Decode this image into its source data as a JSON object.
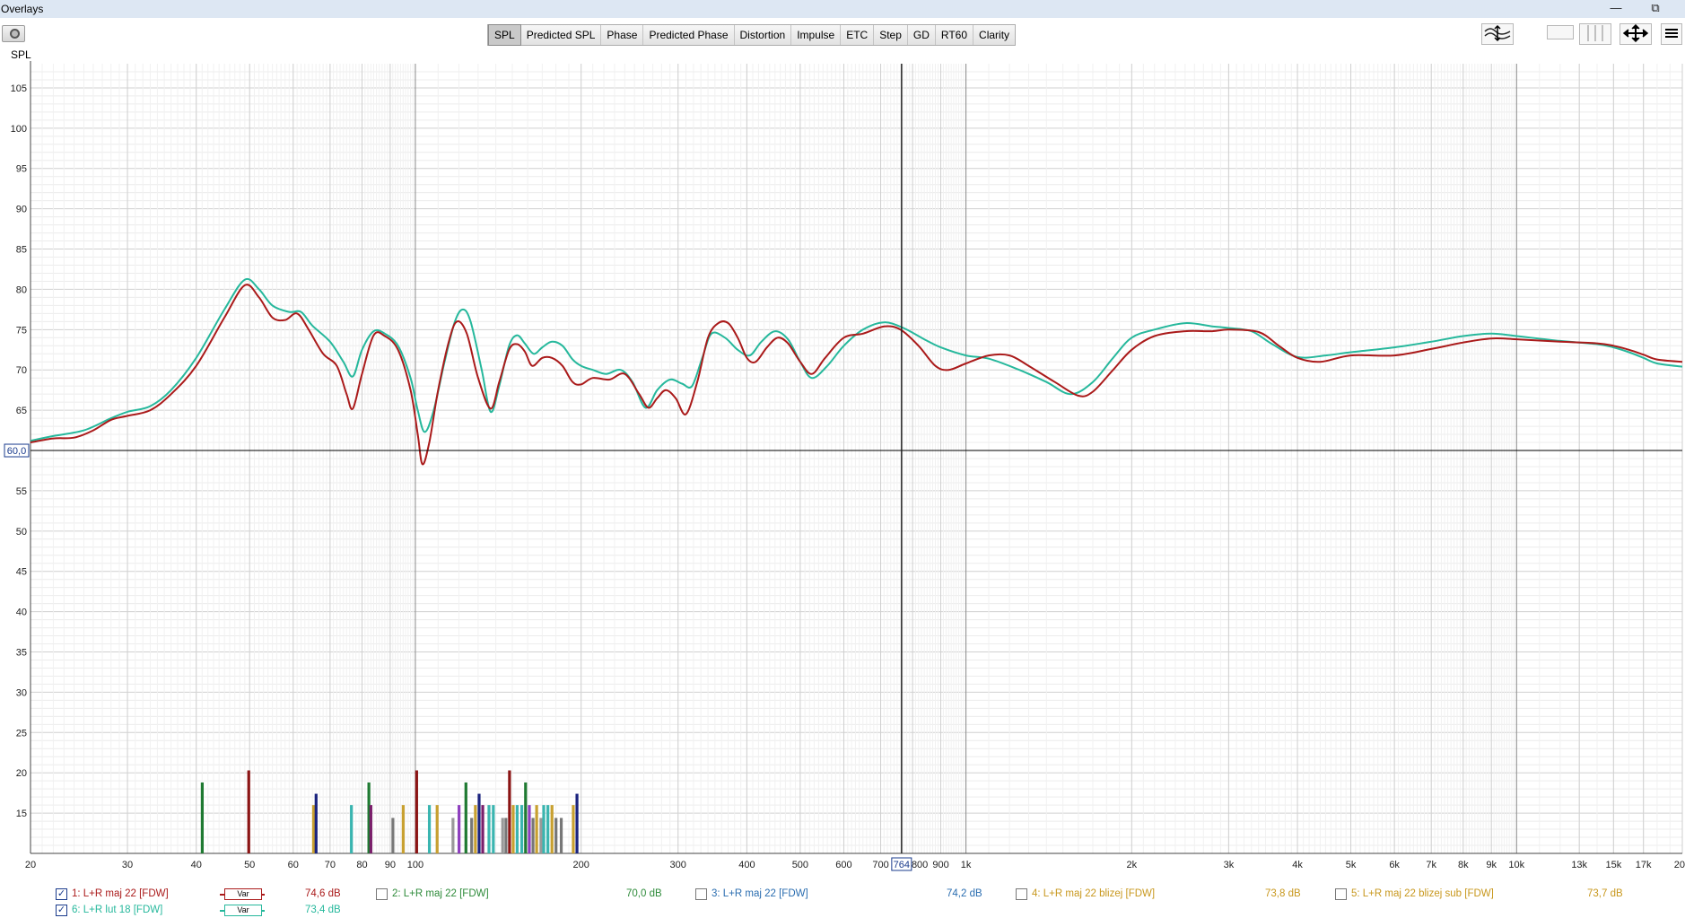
{
  "window": {
    "title": "Overlays",
    "minimize_glyph": "—",
    "restore_glyph": "⧉"
  },
  "toolbar": {
    "tabs": [
      "SPL",
      "Predicted SPL",
      "Phase",
      "Predicted Phase",
      "Distortion",
      "Impulse",
      "ETC",
      "Step",
      "GD",
      "RT60",
      "Clarity"
    ],
    "active_tab": "SPL",
    "right_tools": [
      "traces-icon",
      "single-view-icon",
      "split-view-icon",
      "pan-zoom-icon",
      "controls-menu-icon"
    ]
  },
  "plot": {
    "y_axis_label": "SPL",
    "cursor_y_readout": "60,0",
    "cursor_x_readout": "764"
  },
  "chart_data": {
    "type": "line",
    "ylabel": "SPL",
    "xlabel": "",
    "x_scale": "log",
    "xlim": [
      20,
      20000
    ],
    "ylim": [
      10,
      108
    ],
    "y_ticks": [
      15,
      20,
      25,
      30,
      35,
      40,
      45,
      50,
      55,
      60,
      65,
      70,
      75,
      80,
      85,
      90,
      95,
      100,
      105
    ],
    "x_ticks": [
      {
        "v": 20,
        "label": "20"
      },
      {
        "v": 30,
        "label": "30"
      },
      {
        "v": 40,
        "label": "40"
      },
      {
        "v": 50,
        "label": "50"
      },
      {
        "v": 60,
        "label": "60"
      },
      {
        "v": 70,
        "label": "70"
      },
      {
        "v": 80,
        "label": "80"
      },
      {
        "v": 90,
        "label": "90"
      },
      {
        "v": 100,
        "label": "100"
      },
      {
        "v": 200,
        "label": "200"
      },
      {
        "v": 300,
        "label": "300"
      },
      {
        "v": 400,
        "label": "400"
      },
      {
        "v": 500,
        "label": "500"
      },
      {
        "v": 600,
        "label": "600"
      },
      {
        "v": 700,
        "label": "700"
      },
      {
        "v": 800,
        "label": "800"
      },
      {
        "v": 900,
        "label": "900"
      },
      {
        "v": 1000,
        "label": "1k"
      },
      {
        "v": 2000,
        "label": "2k"
      },
      {
        "v": 3000,
        "label": "3k"
      },
      {
        "v": 4000,
        "label": "4k"
      },
      {
        "v": 5000,
        "label": "5k"
      },
      {
        "v": 6000,
        "label": "6k"
      },
      {
        "v": 7000,
        "label": "7k"
      },
      {
        "v": 8000,
        "label": "8k"
      },
      {
        "v": 9000,
        "label": "9k"
      },
      {
        "v": 10000,
        "label": "10k"
      },
      {
        "v": 13000,
        "label": "13k"
      },
      {
        "v": 15000,
        "label": "15k"
      },
      {
        "v": 17000,
        "label": "17k"
      },
      {
        "v": 20000,
        "label": "20"
      }
    ],
    "cursor": {
      "x": 764,
      "y": 60.0
    },
    "series": [
      {
        "color": "#26b89c",
        "points": [
          [
            20,
            61.2
          ],
          [
            22,
            61.8
          ],
          [
            25,
            62.5
          ],
          [
            28,
            64.0
          ],
          [
            30,
            64.8
          ],
          [
            33,
            65.5
          ],
          [
            36,
            67.5
          ],
          [
            40,
            71.5
          ],
          [
            45,
            77.5
          ],
          [
            49,
            81.2
          ],
          [
            52,
            80.0
          ],
          [
            55,
            78.0
          ],
          [
            59,
            77.2
          ],
          [
            62,
            77.2
          ],
          [
            65,
            75.5
          ],
          [
            70,
            73.5
          ],
          [
            74,
            71.0
          ],
          [
            77,
            69.2
          ],
          [
            80,
            72.5
          ],
          [
            84,
            74.8
          ],
          [
            88,
            74.5
          ],
          [
            93,
            73.0
          ],
          [
            98,
            69.0
          ],
          [
            101,
            65.0
          ],
          [
            104,
            62.3
          ],
          [
            108,
            65.0
          ],
          [
            113,
            71.0
          ],
          [
            118,
            76.0
          ],
          [
            122,
            77.5
          ],
          [
            126,
            76.0
          ],
          [
            132,
            70.0
          ],
          [
            137,
            64.8
          ],
          [
            142,
            68.0
          ],
          [
            148,
            73.0
          ],
          [
            153,
            74.3
          ],
          [
            158,
            73.3
          ],
          [
            164,
            72.0
          ],
          [
            170,
            72.8
          ],
          [
            177,
            73.5
          ],
          [
            185,
            73.0
          ],
          [
            193,
            71.3
          ],
          [
            200,
            70.5
          ],
          [
            210,
            70.0
          ],
          [
            222,
            69.5
          ],
          [
            236,
            70.0
          ],
          [
            248,
            68.5
          ],
          [
            262,
            65.3
          ],
          [
            275,
            67.5
          ],
          [
            290,
            68.8
          ],
          [
            305,
            68.3
          ],
          [
            318,
            68.0
          ],
          [
            332,
            71.5
          ],
          [
            345,
            74.5
          ],
          [
            365,
            74.0
          ],
          [
            385,
            72.5
          ],
          [
            405,
            71.8
          ],
          [
            425,
            73.5
          ],
          [
            450,
            74.8
          ],
          [
            475,
            73.8
          ],
          [
            500,
            71.0
          ],
          [
            525,
            69.0
          ],
          [
            560,
            70.5
          ],
          [
            600,
            73.0
          ],
          [
            650,
            75.0
          ],
          [
            710,
            75.9
          ],
          [
            770,
            75.2
          ],
          [
            840,
            73.8
          ],
          [
            900,
            72.8
          ],
          [
            1000,
            71.8
          ],
          [
            1100,
            71.4
          ],
          [
            1250,
            70.0
          ],
          [
            1400,
            68.5
          ],
          [
            1550,
            67.0
          ],
          [
            1700,
            68.5
          ],
          [
            1850,
            71.5
          ],
          [
            2000,
            74.0
          ],
          [
            2200,
            75.0
          ],
          [
            2500,
            75.8
          ],
          [
            2800,
            75.4
          ],
          [
            3000,
            75.2
          ],
          [
            3300,
            74.8
          ],
          [
            3600,
            73.2
          ],
          [
            4000,
            71.6
          ],
          [
            4500,
            71.8
          ],
          [
            5000,
            72.2
          ],
          [
            6000,
            72.8
          ],
          [
            7000,
            73.5
          ],
          [
            8000,
            74.2
          ],
          [
            9000,
            74.5
          ],
          [
            10000,
            74.2
          ],
          [
            12000,
            73.6
          ],
          [
            14000,
            73.2
          ],
          [
            15000,
            72.8
          ],
          [
            16000,
            72.2
          ],
          [
            17000,
            71.5
          ],
          [
            18000,
            70.8
          ],
          [
            20000,
            70.4
          ]
        ]
      },
      {
        "color": "#aa1a1a",
        "points": [
          [
            20,
            61.0
          ],
          [
            22,
            61.5
          ],
          [
            24,
            61.6
          ],
          [
            26,
            62.5
          ],
          [
            28,
            63.8
          ],
          [
            30,
            64.3
          ],
          [
            33,
            65.0
          ],
          [
            36,
            67.0
          ],
          [
            40,
            70.5
          ],
          [
            45,
            76.5
          ],
          [
            49,
            80.5
          ],
          [
            52,
            79.0
          ],
          [
            55,
            76.5
          ],
          [
            58,
            76.2
          ],
          [
            61,
            77.0
          ],
          [
            64,
            75.0
          ],
          [
            68,
            72.0
          ],
          [
            72,
            70.5
          ],
          [
            75,
            67.0
          ],
          [
            77,
            65.2
          ],
          [
            80,
            69.5
          ],
          [
            84,
            74.3
          ],
          [
            88,
            74.2
          ],
          [
            93,
            72.5
          ],
          [
            98,
            67.5
          ],
          [
            101,
            62.0
          ],
          [
            103,
            58.3
          ],
          [
            106,
            61.0
          ],
          [
            110,
            67.5
          ],
          [
            115,
            73.5
          ],
          [
            119,
            76.0
          ],
          [
            124,
            74.5
          ],
          [
            130,
            69.0
          ],
          [
            137,
            65.2
          ],
          [
            142,
            68.5
          ],
          [
            148,
            72.5
          ],
          [
            153,
            73.2
          ],
          [
            158,
            72.3
          ],
          [
            163,
            70.5
          ],
          [
            170,
            71.5
          ],
          [
            177,
            71.5
          ],
          [
            185,
            70.5
          ],
          [
            193,
            68.5
          ],
          [
            200,
            68.2
          ],
          [
            210,
            69.0
          ],
          [
            225,
            68.8
          ],
          [
            240,
            69.5
          ],
          [
            255,
            67.0
          ],
          [
            265,
            65.3
          ],
          [
            275,
            66.5
          ],
          [
            285,
            67.5
          ],
          [
            297,
            66.5
          ],
          [
            310,
            64.5
          ],
          [
            325,
            68.5
          ],
          [
            340,
            74.0
          ],
          [
            355,
            75.8
          ],
          [
            370,
            75.8
          ],
          [
            385,
            74.0
          ],
          [
            400,
            71.5
          ],
          [
            415,
            71.0
          ],
          [
            435,
            72.8
          ],
          [
            455,
            74.0
          ],
          [
            475,
            73.3
          ],
          [
            500,
            71.0
          ],
          [
            525,
            69.5
          ],
          [
            555,
            71.5
          ],
          [
            600,
            74.0
          ],
          [
            650,
            74.5
          ],
          [
            710,
            75.4
          ],
          [
            760,
            75.0
          ],
          [
            820,
            73.0
          ],
          [
            880,
            70.5
          ],
          [
            930,
            70.0
          ],
          [
            1000,
            70.8
          ],
          [
            1100,
            71.8
          ],
          [
            1200,
            71.8
          ],
          [
            1300,
            70.5
          ],
          [
            1450,
            68.5
          ],
          [
            1600,
            66.8
          ],
          [
            1700,
            67.3
          ],
          [
            1850,
            70.0
          ],
          [
            2000,
            72.5
          ],
          [
            2200,
            74.2
          ],
          [
            2500,
            74.8
          ],
          [
            2800,
            74.8
          ],
          [
            3000,
            75.0
          ],
          [
            3400,
            74.7
          ],
          [
            3700,
            73.0
          ],
          [
            4000,
            71.5
          ],
          [
            4400,
            71.0
          ],
          [
            5000,
            71.8
          ],
          [
            6000,
            71.8
          ],
          [
            7000,
            72.6
          ],
          [
            8000,
            73.4
          ],
          [
            9000,
            73.9
          ],
          [
            10000,
            73.8
          ],
          [
            12000,
            73.5
          ],
          [
            14000,
            73.3
          ],
          [
            15000,
            73.0
          ],
          [
            16000,
            72.5
          ],
          [
            17000,
            71.9
          ],
          [
            18000,
            71.3
          ],
          [
            20000,
            71.0
          ]
        ]
      }
    ],
    "bars": [
      {
        "f": 41,
        "h": 18.8,
        "c": "#1f7a32"
      },
      {
        "f": 49.8,
        "h": 20.3,
        "c": "#8b1414"
      },
      {
        "f": 65.3,
        "h": 16.0,
        "c": "#c8a030"
      },
      {
        "f": 66,
        "h": 17.4,
        "c": "#1a237e"
      },
      {
        "f": 76.5,
        "h": 16.0,
        "c": "#3ab5b0"
      },
      {
        "f": 82.3,
        "h": 18.8,
        "c": "#1f7a32"
      },
      {
        "f": 83,
        "h": 16.0,
        "c": "#7a1f6b"
      },
      {
        "f": 91,
        "h": 14.4,
        "c": "#777777"
      },
      {
        "f": 95,
        "h": 16.0,
        "c": "#c8a030"
      },
      {
        "f": 100.5,
        "h": 20.3,
        "c": "#8b1414"
      },
      {
        "f": 106,
        "h": 16.0,
        "c": "#3ab5b0"
      },
      {
        "f": 109.5,
        "h": 16.0,
        "c": "#c8a030"
      },
      {
        "f": 117,
        "h": 14.4,
        "c": "#999999"
      },
      {
        "f": 120,
        "h": 16.0,
        "c": "#8e3fbf"
      },
      {
        "f": 123.5,
        "h": 18.8,
        "c": "#1f7a32"
      },
      {
        "f": 126.5,
        "h": 14.4,
        "c": "#777777"
      },
      {
        "f": 128.5,
        "h": 16.0,
        "c": "#c8a030"
      },
      {
        "f": 130.5,
        "h": 17.4,
        "c": "#1a237e"
      },
      {
        "f": 132.5,
        "h": 16.0,
        "c": "#7a1f6b"
      },
      {
        "f": 136,
        "h": 16.0,
        "c": "#3ab5b0"
      },
      {
        "f": 138.5,
        "h": 16.0,
        "c": "#3ab5b0"
      },
      {
        "f": 144,
        "h": 14.4,
        "c": "#999999"
      },
      {
        "f": 146,
        "h": 14.4,
        "c": "#777777"
      },
      {
        "f": 148.2,
        "h": 20.3,
        "c": "#8b1414"
      },
      {
        "f": 150.5,
        "h": 16.0,
        "c": "#c8a030"
      },
      {
        "f": 153,
        "h": 16.0,
        "c": "#3ab5b0"
      },
      {
        "f": 156,
        "h": 16.0,
        "c": "#3ab5b0"
      },
      {
        "f": 158.5,
        "h": 18.8,
        "c": "#1f7a32"
      },
      {
        "f": 161,
        "h": 16.0,
        "c": "#8e3fbf"
      },
      {
        "f": 163.5,
        "h": 14.4,
        "c": "#777777"
      },
      {
        "f": 166,
        "h": 16.0,
        "c": "#c8a030"
      },
      {
        "f": 169,
        "h": 14.4,
        "c": "#999999"
      },
      {
        "f": 171,
        "h": 16.0,
        "c": "#3ab5b0"
      },
      {
        "f": 174,
        "h": 16.0,
        "c": "#3ab5b0"
      },
      {
        "f": 177,
        "h": 16.0,
        "c": "#c8a030"
      },
      {
        "f": 180,
        "h": 14.4,
        "c": "#777777"
      },
      {
        "f": 184,
        "h": 14.4,
        "c": "#777777"
      },
      {
        "f": 193.5,
        "h": 16.0,
        "c": "#c8a030"
      },
      {
        "f": 196.5,
        "h": 17.4,
        "c": "#1a237e"
      }
    ]
  },
  "legend": [
    {
      "label": "1: L+R maj 22 [FDW]",
      "value": "74,6 dB",
      "color": "#aa1a1a",
      "checked": true,
      "var": "Var"
    },
    {
      "label": "2: L+R maj 22 [FDW]",
      "value": "70,0 dB",
      "color": "#2e8b3a",
      "checked": false,
      "var": ""
    },
    {
      "label": "3: L+R maj 22 [FDW]",
      "value": "74,2 dB",
      "color": "#2a6db0",
      "checked": false,
      "var": ""
    },
    {
      "label": "4: L+R maj 22 blizej [FDW]",
      "value": "73,8 dB",
      "color": "#c8981e",
      "checked": false,
      "var": ""
    },
    {
      "label": "5: L+R maj 22 blizej sub [FDW]",
      "value": "73,7 dB",
      "color": "#c8981e",
      "checked": false,
      "var": ""
    },
    {
      "label": "6: L+R lut 18 [FDW]",
      "value": "73,4 dB",
      "color": "#26b89c",
      "checked": true,
      "var": "Var"
    }
  ]
}
